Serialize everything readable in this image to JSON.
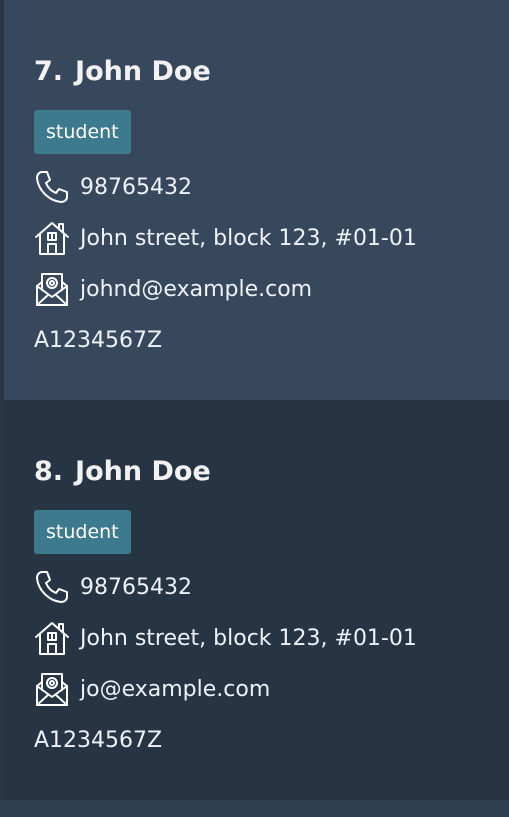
{
  "persons": [
    {
      "index": "7.",
      "name": "John Doe",
      "tag": "student",
      "phone": "98765432",
      "address": "John street, block 123, #01-01",
      "email": "johnd@example.com",
      "id": "A1234567Z",
      "icons": {
        "phone": "phone-icon",
        "address": "house-icon",
        "email": "email-envelope-icon"
      }
    },
    {
      "index": "8.",
      "name": "John Doe",
      "tag": "student",
      "phone": "98765432",
      "address": "John street, block 123, #01-01",
      "email": "jo@example.com",
      "id": "A1234567Z",
      "icons": {
        "phone": "phone-icon",
        "address": "house-icon",
        "email": "email-envelope-icon"
      }
    }
  ],
  "colors": {
    "card_selected": "#37485d",
    "card_default": "#263444",
    "tag_bg": "#3d7a8e",
    "text": "#eef2f6"
  }
}
